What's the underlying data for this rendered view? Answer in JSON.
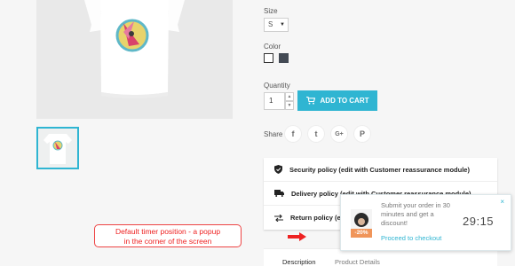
{
  "product": {
    "size_label": "Size",
    "size_value": "S",
    "color_label": "Color",
    "quantity_label": "Quantity",
    "quantity_value": "1",
    "add_to_cart": "ADD TO CART",
    "share_label": "Share",
    "share_buttons": [
      "f",
      "t",
      "G+",
      "P"
    ]
  },
  "reassurance": [
    {
      "icon": "shield-icon",
      "label": "Security policy (edit with Customer reassurance module)"
    },
    {
      "icon": "truck-icon",
      "label": "Delivery policy (edit with Customer reassurance module)"
    },
    {
      "icon": "exchange-icon",
      "label": "Return policy (edit with Customer reassurance module)"
    }
  ],
  "tabs": [
    "Description",
    "Product Details"
  ],
  "annotation": {
    "text_line1": "Default timer position - a popup",
    "text_line2": "in the corner of the screen"
  },
  "popup": {
    "message": "Submit your order in 30 minutes and get a discount!",
    "discount": "-20%",
    "timer": "29:15",
    "proceed": "Proceed to checkout",
    "close": "×"
  },
  "colors": {
    "accent": "#2fb5d2",
    "annotation_red": "#e22222",
    "discount_orange": "#f0955a",
    "swatch_dark": "#434a54"
  }
}
